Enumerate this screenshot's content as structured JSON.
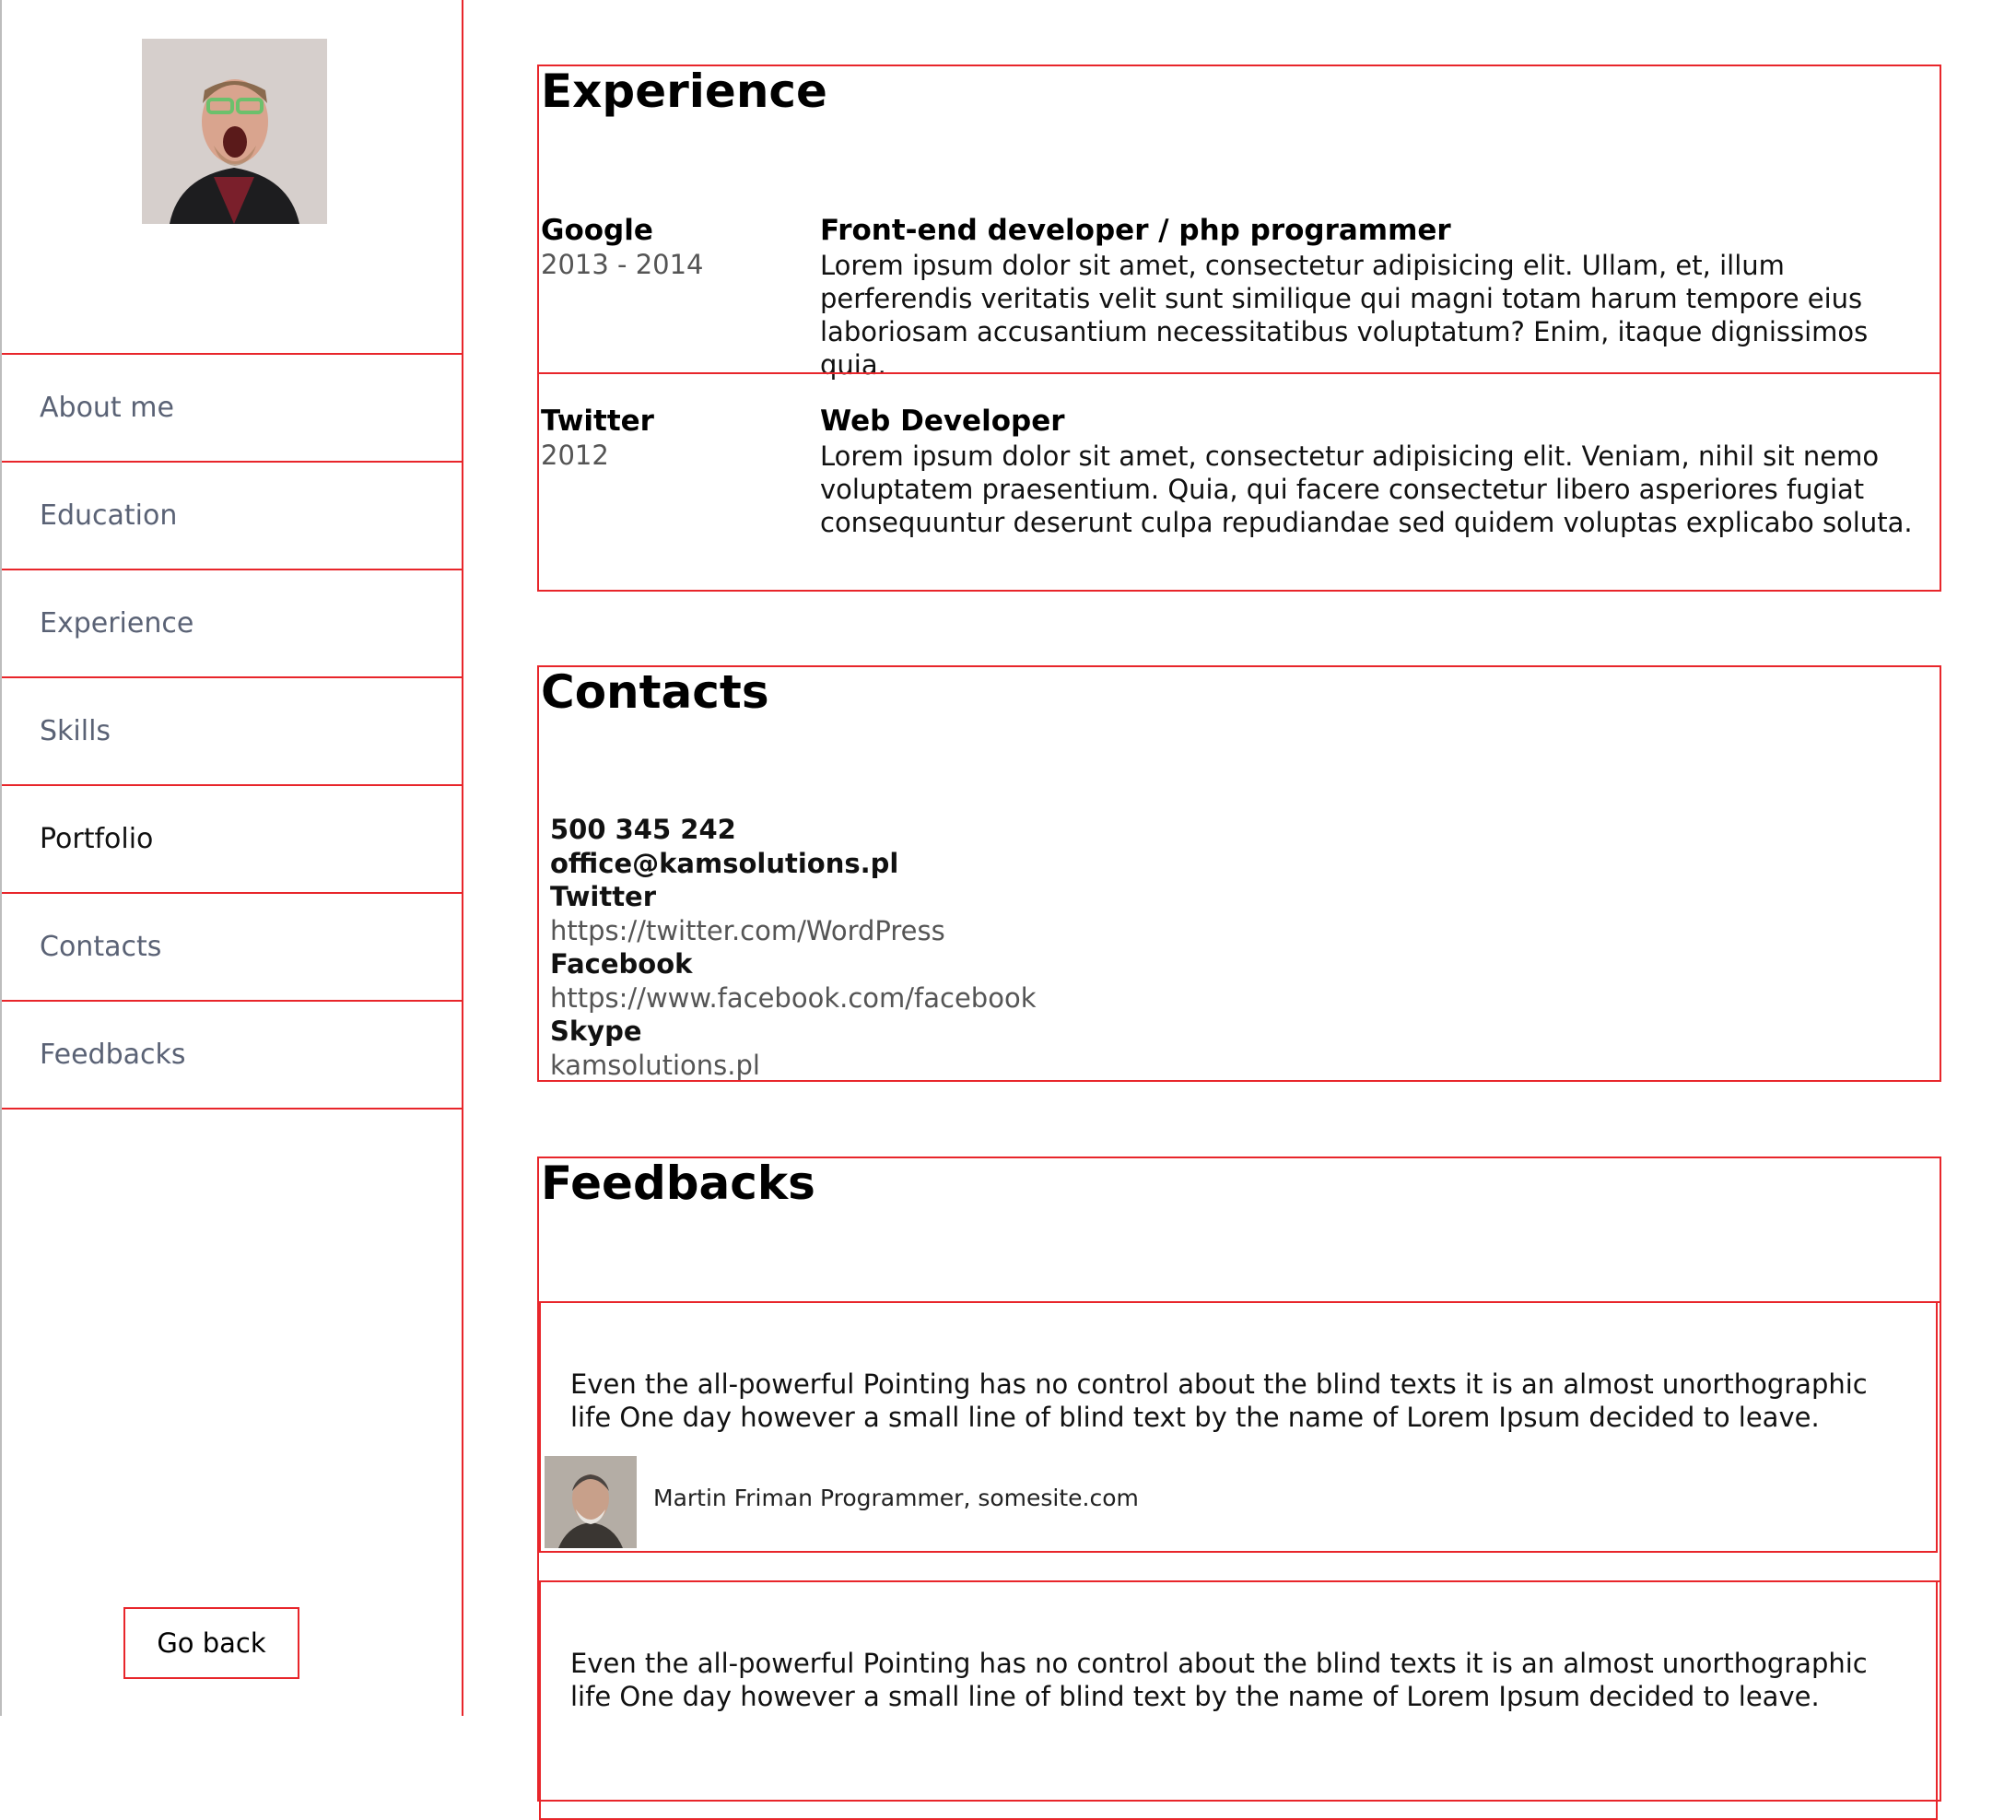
{
  "sidebar": {
    "avatar_alt": "profile photo",
    "nav": [
      {
        "label": "About me",
        "active": false
      },
      {
        "label": "Education",
        "active": false
      },
      {
        "label": "Experience",
        "active": false
      },
      {
        "label": "Skills",
        "active": false
      },
      {
        "label": "Portfolio",
        "active": true
      },
      {
        "label": "Contacts",
        "active": false
      },
      {
        "label": "Feedbacks",
        "active": false
      }
    ],
    "go_back": "Go back"
  },
  "experience": {
    "title": "Experience",
    "jobs": [
      {
        "company": "Google",
        "years": "2013 - 2014",
        "title": "Front-end developer / php programmer",
        "description": "Lorem ipsum dolor sit amet, consectetur adipisicing elit. Ullam, et, illum perferendis veritatis velit sunt similique qui magni totam harum tempore eius laboriosam accusantium necessitatibus voluptatum? Enim, itaque dignissimos quia."
      },
      {
        "company": "Twitter",
        "years": "2012",
        "title": "Web Developer",
        "description": "Lorem ipsum dolor sit amet, consectetur adipisicing elit. Veniam, nihil sit nemo voluptatem praesentium. Quia, qui facere consectetur libero asperiores fugiat consequuntur deserunt culpa repudiandae sed quidem voluptas explicabo soluta."
      }
    ]
  },
  "contacts": {
    "title": "Contacts",
    "phone": "500 345 242",
    "email": "office@kamsolutions.pl",
    "twitter_label": "Twitter",
    "twitter_url": "https://twitter.com/WordPress",
    "facebook_label": "Facebook",
    "facebook_url": "https://www.facebook.com/facebook",
    "skype_label": "Skype",
    "skype_value": "kamsolutions.pl"
  },
  "feedbacks": {
    "title": "Feedbacks",
    "items": [
      {
        "text": "Even the all-powerful Pointing has no control about the blind texts it is an almost unorthographic life One day however a small line of blind text by the name of Lorem Ipsum decided to leave.",
        "author": "Martin Friman Programmer, somesite.com"
      },
      {
        "text": "Even the all-powerful Pointing has no control about the blind texts it is an almost unorthographic life One day however a small line of blind text by the name of Lorem Ipsum decided to leave.",
        "author": ""
      }
    ]
  },
  "colors": {
    "accent": "#e8262b",
    "nav_text": "#5a6275"
  }
}
